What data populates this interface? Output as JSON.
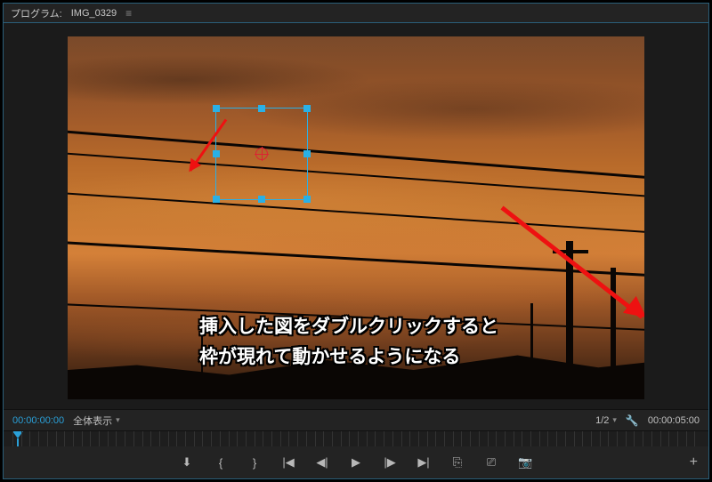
{
  "titlebar": {
    "label_prefix": "プログラム:",
    "clip_name": "IMG_0329"
  },
  "annotation": {
    "line1": "挿入した図をダブルクリックすると",
    "line2": "枠が現れて動かせるようになる"
  },
  "infobar": {
    "current_timecode": "00:00:00:00",
    "zoom_label": "全体表示",
    "resolution_label": "1/2",
    "total_timecode": "00:00:05:00"
  },
  "icons": {
    "menu": "≡",
    "chevron_down": "▾",
    "wrench": "🔧",
    "plus": "+"
  },
  "transport": {
    "mark_in": "⬇",
    "mark_out_open": "{",
    "mark_out_close": "}",
    "go_in": "|◀",
    "step_back": "◀|",
    "play": "▶",
    "step_fwd": "|▶",
    "go_out": "▶|",
    "lift": "⎘",
    "extract": "⎚",
    "export_frame": "📷"
  }
}
